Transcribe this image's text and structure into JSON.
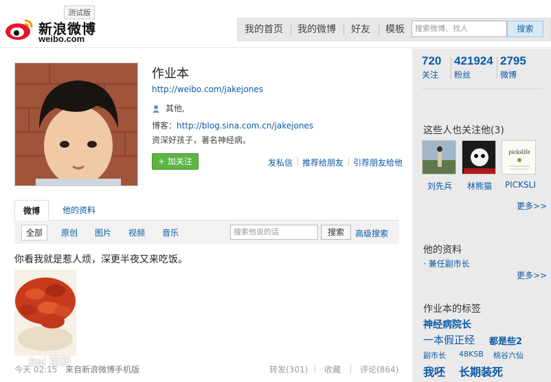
{
  "header": {
    "logo_cn": "新浪微博",
    "logo_en": "weibo.com",
    "beta": "测试版",
    "nav": [
      "我的首页",
      "我的微博",
      "好友",
      "模板"
    ],
    "search_placeholder": "搜索微博、找人",
    "search_button": "搜索"
  },
  "profile": {
    "name": "作业本",
    "url": "http://weibo.com/jakejones",
    "gender_location": "其他,",
    "blog_label": "博客：",
    "blog_url": "http://blog.sina.com.cn/jakejones",
    "intro": "资深好孩子，著名神经病。",
    "follow_button": "+ 加关注",
    "actions": [
      "发私信",
      "推荐给朋友",
      "引荐朋友给他"
    ]
  },
  "tabs": [
    "微博",
    "他的资料"
  ],
  "filters": [
    "全部",
    "原创",
    "图片",
    "视频",
    "音乐"
  ],
  "feed_search": {
    "placeholder": "搜索他说的话",
    "button": "搜索",
    "advanced": "高级搜索"
  },
  "post": {
    "text": "你看我就是惹人烦，深更半夜又来吃饭。",
    "time": "今天 02:15",
    "source": "来自新浪微博手机版",
    "repost": "转发(301)",
    "favorite": "收藏",
    "comment": "评论(864)",
    "watermark": "Bai 百科"
  },
  "sidebar": {
    "stats": [
      {
        "num": "720",
        "label": "关注"
      },
      {
        "num": "421924",
        "label": "粉丝"
      },
      {
        "num": "2795",
        "label": "微博"
      }
    ],
    "also_follow_title": "这些人也关注他(3)",
    "also_follow": [
      "刘先兵",
      "林熊猫",
      "PICKSLI"
    ],
    "pickslife_text": "pickslife",
    "more": "更多>>",
    "info_title": "他的资料",
    "info_item": "兼任副市长",
    "tags_title": "作业本的标签",
    "tags": [
      "神经病院长",
      "一本假正经",
      "都是些2",
      "副市长",
      "48KSB",
      "桃谷六仙",
      "我呸",
      "长期装死"
    ]
  }
}
